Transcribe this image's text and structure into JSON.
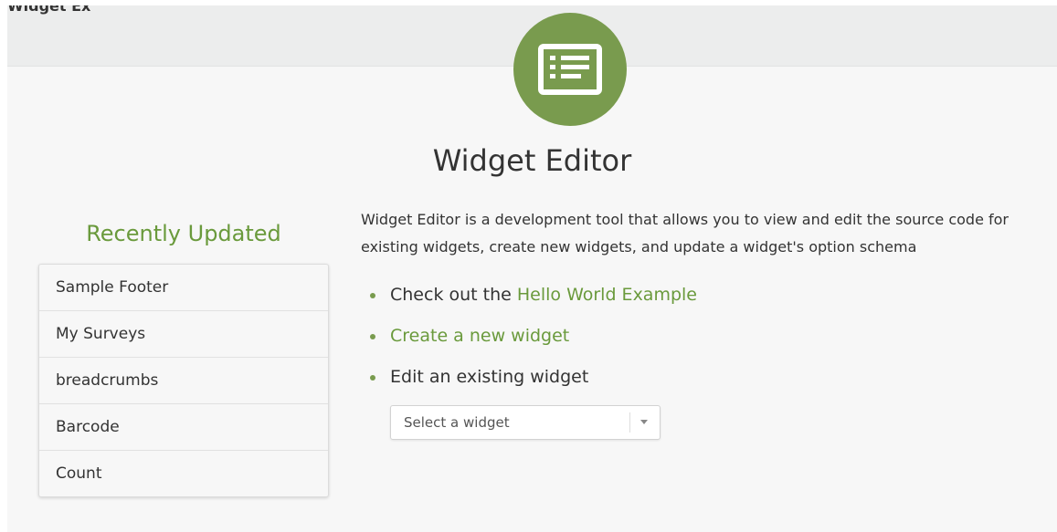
{
  "header": {
    "top_cut_text": "Widget Ex"
  },
  "logo": {
    "icon": "widget-panel-icon",
    "color": "#799b4e"
  },
  "main": {
    "title": "Widget Editor",
    "description_emph": "Widget Editor",
    "description_rest": " is a development tool that allows you to view and edit the source code for existing widgets, create new widgets, and update a widget's option schema",
    "actions": {
      "check_out_prefix": "Check out the ",
      "hello_world_link": "Hello World Example",
      "create_link": "Create a new widget",
      "edit_text": "Edit an existing widget"
    },
    "select": {
      "placeholder": "Select a widget"
    }
  },
  "sidebar": {
    "title": "Recently Updated",
    "items": [
      {
        "label": "Sample Footer"
      },
      {
        "label": "My Surveys"
      },
      {
        "label": "breadcrumbs"
      },
      {
        "label": "Barcode"
      },
      {
        "label": "Count"
      }
    ]
  },
  "colors": {
    "accent": "#799b4e",
    "link": "#6a9a3c"
  }
}
